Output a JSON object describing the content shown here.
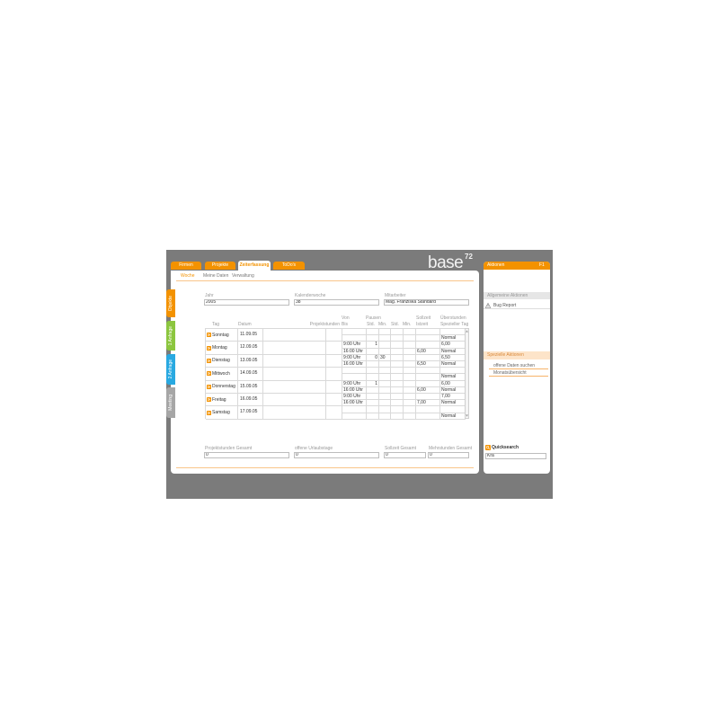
{
  "colors": {
    "orange": "#f39200",
    "green": "#8cc63f",
    "blue": "#29a9e1",
    "side_tab_gray": "#a6a6a6",
    "frame_gray": "#7b7b7b"
  },
  "logo": {
    "text": "base",
    "sup": "72"
  },
  "top_tabs": [
    {
      "label": "Firmen"
    },
    {
      "label": "Projekte"
    },
    {
      "label": "Zeiterfassung",
      "active": true
    },
    {
      "label": "ToDo's"
    }
  ],
  "subnav": [
    {
      "label": "Woche",
      "active": true
    },
    {
      "label": "Meine Daten"
    },
    {
      "label": "Verwaltung"
    }
  ],
  "side_tabs": [
    {
      "label": "Objekte"
    },
    {
      "label": "1 Anfrage"
    },
    {
      "label": "2 Anfrage"
    },
    {
      "label": "Meeting"
    }
  ],
  "filters": {
    "year_label": "Jahr",
    "year": "2005",
    "week_label": "Kalenderwoche",
    "week": "38",
    "employee_label": "Mitarbeiter",
    "employee": "Mag. Franziska Standard"
  },
  "table": {
    "headers": {
      "tag": "Tag",
      "datum": "Datum",
      "projekt": "Projektstunden",
      "von": "Von",
      "bis": "Bis",
      "pausen": "Pausen",
      "std1": "Std.",
      "min1": "Min.",
      "std2": "Std.",
      "min2": "Min.",
      "soll": "Sollzeit",
      "ist": "Istzeit",
      "overtime": "Überstunden",
      "special": "Spezieller Tag"
    },
    "rows": [
      {
        "day": "Sonntag",
        "date": "11.09.05",
        "special": "Normal"
      },
      {
        "day": "Montag",
        "date": "12.09.05",
        "von": "9:00 Uhr",
        "bis": "16:00 Uhr",
        "pause_std": "1",
        "ist": "6,00",
        "overtime": "6,00",
        "special": "Normal"
      },
      {
        "day": "Dienstag",
        "date": "13.09.05",
        "von": "9:00 Uhr",
        "bis": "16:00 Uhr",
        "pause_std": "0",
        "pause_min": "30",
        "ist": "6,50",
        "overtime": "6,50",
        "special": "Normal"
      },
      {
        "day": "Mittwoch",
        "date": "14.09.05",
        "special": "Normal"
      },
      {
        "day": "Donnerstag",
        "date": "15.09.05",
        "von": "9:00 Uhr",
        "bis": "16:00 Uhr",
        "pause_std": "1",
        "ist": "6,00",
        "overtime": "6,00",
        "special": "Normal"
      },
      {
        "day": "Freitag",
        "date": "16.09.05",
        "von": "9:00 Uhr",
        "bis": "16:00 Uhr",
        "ist": "7,00",
        "overtime": "7,00",
        "special": "Normal"
      },
      {
        "day": "Samstag",
        "date": "17.09.05",
        "special": "Normal"
      }
    ]
  },
  "totals": {
    "project_label": "Projektstunden Gesamt",
    "project": "0",
    "vacation_label": "offene Urlaubstage",
    "vacation": "0",
    "soll_label": "Sollzeit Gesamt",
    "soll": "0",
    "extra_label": "Mehrstunden Gesamt",
    "extra": "0"
  },
  "actions": {
    "title": "Aktionen",
    "shortcut": "F1",
    "general_title": "Allgemeine Aktionen",
    "general": [
      {
        "label": "Bug Report",
        "icon": "warning-icon"
      }
    ],
    "special_title": "Spezielle Aktionen",
    "special": [
      {
        "label": "offene Daten suchen"
      },
      {
        "label": "Monatsübersicht"
      }
    ]
  },
  "quicksearch": {
    "label": "Quicksearch",
    "value": "Kra",
    "icon": "quicksearch-icon"
  }
}
